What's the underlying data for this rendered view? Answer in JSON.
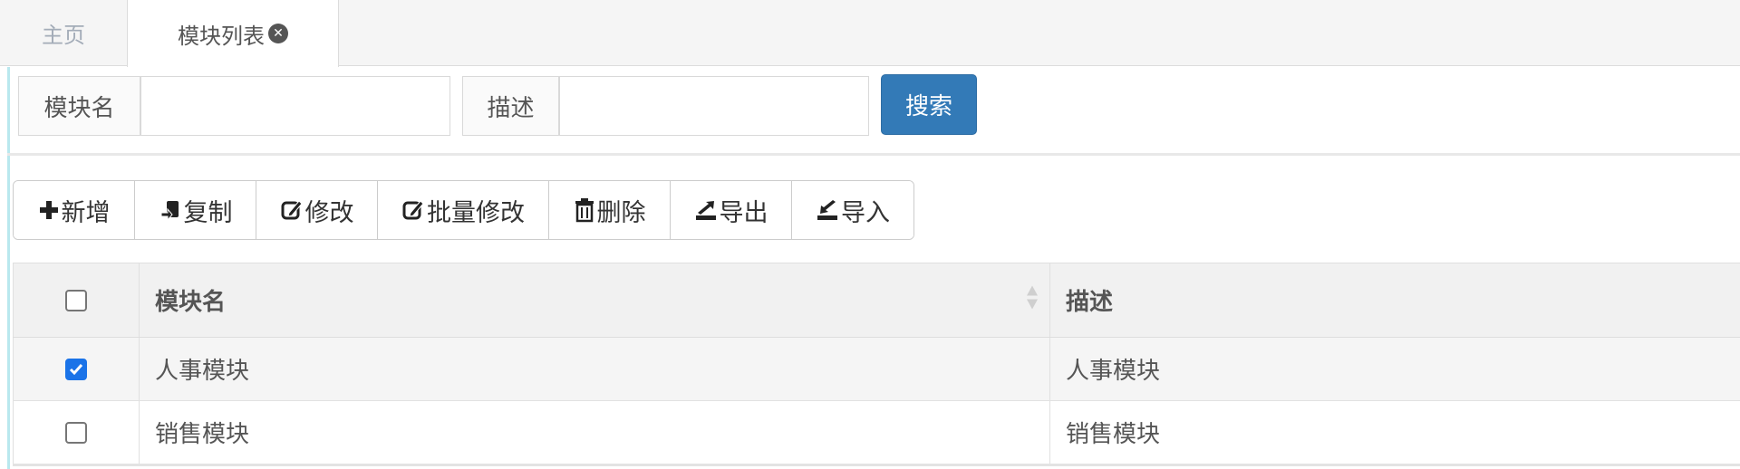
{
  "tabs": {
    "home_label": "主页",
    "active_label": "模块列表",
    "close_glyph": "✕"
  },
  "search": {
    "name_label": "模块名",
    "name_value": "",
    "desc_label": "描述",
    "desc_value": "",
    "button_label": "搜索"
  },
  "toolbar": {
    "add_label": "新增",
    "copy_label": "复制",
    "edit_label": "修改",
    "batch_edit_label": "批量修改",
    "delete_label": "删除",
    "export_label": "导出",
    "import_label": "导入"
  },
  "table": {
    "headers": {
      "name": "模块名",
      "desc": "描述"
    },
    "header_checked": false,
    "rows": [
      {
        "name": "人事模块",
        "desc": "人事模块",
        "checked": true
      },
      {
        "name": "销售模块",
        "desc": "销售模块",
        "checked": false
      }
    ]
  },
  "colors": {
    "primary": "#337ab7",
    "checkbox_checked": "#1a73e8",
    "accent_line": "#b9e8ee"
  }
}
